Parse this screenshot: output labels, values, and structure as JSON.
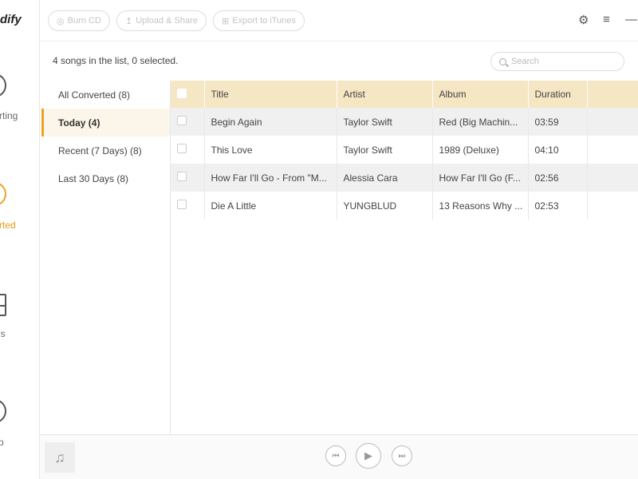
{
  "app": {
    "logo_text": "dify"
  },
  "sidebar": {
    "items": [
      {
        "label": "rting",
        "active": false
      },
      {
        "label": "rted",
        "active": true
      },
      {
        "label": "ls",
        "active": false
      },
      {
        "label": "p",
        "active": false
      }
    ]
  },
  "toolbar": {
    "burn_label": "Burn CD",
    "upload_label": "Upload & Share",
    "export_label": "Export to iTunes",
    "settings_icon": "gear-icon",
    "menu_icon": "menu-icon",
    "minimize_icon": "minimize-icon"
  },
  "info": {
    "text": "4 songs in the list, 0 selected."
  },
  "search": {
    "placeholder": "Search",
    "value": ""
  },
  "filters": [
    {
      "label": "All Converted (8)",
      "active": false
    },
    {
      "label": "Today (4)",
      "active": true
    },
    {
      "label": "Recent (7 Days) (8)",
      "active": false
    },
    {
      "label": "Last 30 Days (8)",
      "active": false
    }
  ],
  "table": {
    "headers": {
      "title": "Title",
      "artist": "Artist",
      "album": "Album",
      "duration": "Duration"
    },
    "rows": [
      {
        "title": "Begin Again",
        "artist": "Taylor Swift",
        "album": "Red (Big Machin...",
        "duration": "03:59"
      },
      {
        "title": "This Love",
        "artist": "Taylor Swift",
        "album": "1989 (Deluxe)",
        "duration": "04:10"
      },
      {
        "title": "How Far I'll Go - From \"M...",
        "artist": "Alessia Cara",
        "album": "How Far I'll Go (F...",
        "duration": "02:56"
      },
      {
        "title": "Die A Little",
        "artist": "YUNGBLUD",
        "album": "13 Reasons Why ...",
        "duration": "02:53"
      }
    ]
  },
  "colors": {
    "accent": "#f0a020",
    "header_bg": "#f5e6c4",
    "active_filter_bg": "#fbf5ea"
  }
}
